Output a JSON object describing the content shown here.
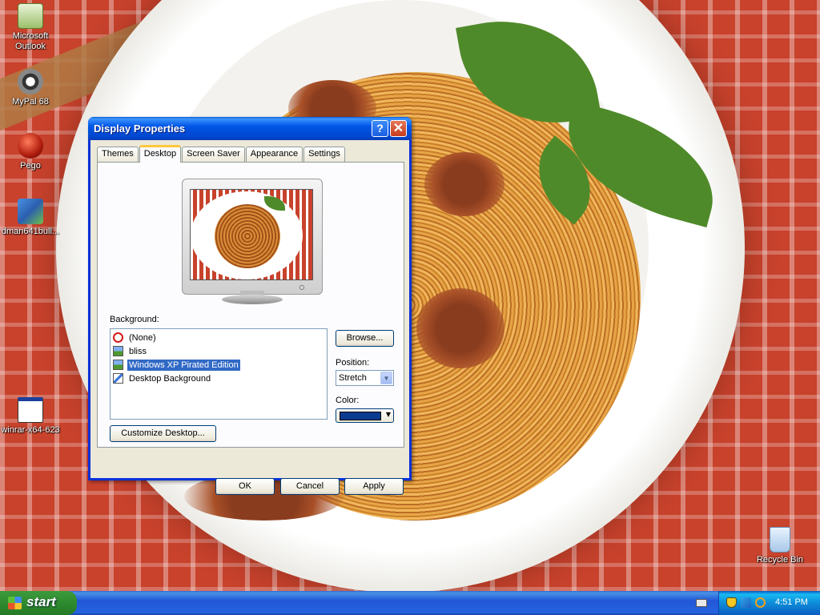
{
  "desktop": {
    "icons": [
      {
        "name": "Microsoft Outlook",
        "line1": "Microsoft",
        "line2": "Outlook"
      },
      {
        "name": "MyPal 68",
        "line1": "MyPal 68",
        "line2": ""
      },
      {
        "name": "Pego",
        "line1": "Pego",
        "line2": ""
      },
      {
        "name": "dman641bull...",
        "line1": "dman641bull...",
        "line2": ""
      },
      {
        "name": "winrar-x64-623",
        "line1": "winrar-x64-623",
        "line2": ""
      },
      {
        "name": "Recycle Bin",
        "line1": "Recycle Bin",
        "line2": ""
      }
    ]
  },
  "dialog": {
    "title": "Display Properties",
    "help_button": "?",
    "close_button": "✕",
    "tabs": [
      {
        "label": "Themes",
        "active": false
      },
      {
        "label": "Desktop",
        "active": true
      },
      {
        "label": "Screen Saver",
        "active": false
      },
      {
        "label": "Appearance",
        "active": false
      },
      {
        "label": "Settings",
        "active": false
      }
    ],
    "background_label": "Background:",
    "background_items": [
      {
        "label": "(None)",
        "icon": "none-icon",
        "selected": false
      },
      {
        "label": "bliss",
        "icon": "image-icon",
        "selected": false
      },
      {
        "label": "Windows XP Pirated Edition",
        "icon": "image-icon",
        "selected": true
      },
      {
        "label": "Desktop Background",
        "icon": "image-icon",
        "selected": false
      }
    ],
    "browse_button": "Browse...",
    "position_label": "Position:",
    "position_value": "Stretch",
    "color_label": "Color:",
    "color_value": "#0b3b8f",
    "customize_button": "Customize Desktop...",
    "ok_button": "OK",
    "cancel_button": "Cancel",
    "apply_button": "Apply"
  },
  "taskbar": {
    "start_label": "start",
    "clock": "4:51 PM"
  }
}
